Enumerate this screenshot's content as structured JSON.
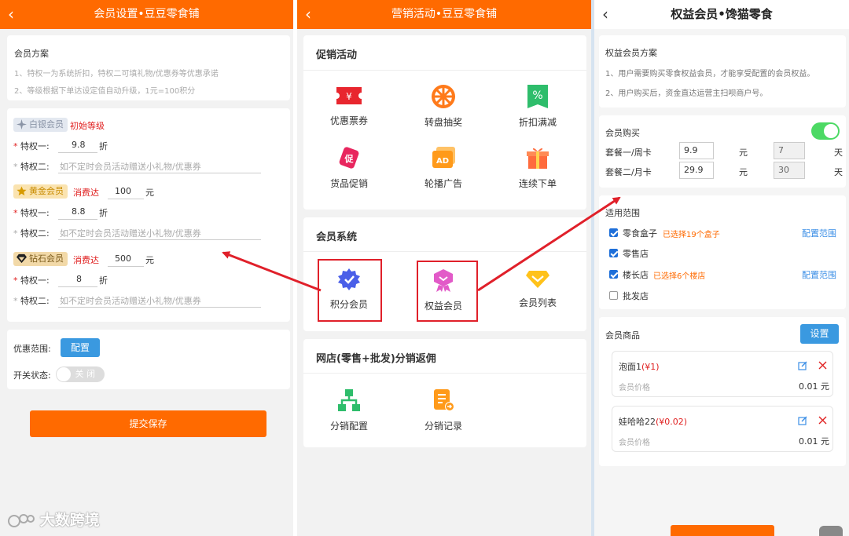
{
  "panel1": {
    "title": "会员设置•豆豆零食铺",
    "plan_title": "会员方案",
    "plan_notes": [
      "1、特权一为系统折扣，特权二可填礼物/优惠券等优惠承诺",
      "2、等级根据下单达设定值自动升级，1元=100积分"
    ],
    "levels": [
      {
        "badge": "白银会员",
        "tag": "初始等级",
        "priv1_label": "特权一:",
        "priv1_value": "9.8",
        "unit": "折",
        "priv2_label": "特权二:",
        "priv2_placeholder": "如不定时会员活动赠送小礼物/优惠券"
      },
      {
        "badge": "黄金会员",
        "tag": "消费达",
        "amount": "100",
        "amount_unit": "元",
        "priv1_label": "特权一:",
        "priv1_value": "8.8",
        "unit": "折",
        "priv2_label": "特权二:",
        "priv2_placeholder": "如不定时会员活动赠送小礼物/优惠券"
      },
      {
        "badge": "钻石会员",
        "tag": "消费达",
        "amount": "500",
        "amount_unit": "元",
        "priv1_label": "特权一:",
        "priv1_value": "8",
        "unit": "折",
        "priv2_label": "特权二:",
        "priv2_placeholder": "如不定时会员活动赠送小礼物/优惠券"
      }
    ],
    "scope_label": "优惠范围:",
    "scope_button": "配置",
    "switch_label": "开关状态:",
    "switch_state": "关 闭",
    "submit": "提交保存",
    "watermark": "大数跨境"
  },
  "panel2": {
    "title": "营销活动•豆豆零食铺",
    "sections": [
      {
        "title": "促销活动",
        "items": [
          "优惠票券",
          "转盘抽奖",
          "折扣满减",
          "货品促销",
          "轮播广告",
          "连续下单"
        ]
      },
      {
        "title": "会员系统",
        "items": [
          "积分会员",
          "权益会员",
          "会员列表"
        ]
      },
      {
        "title": "网店(零售+批发)分销返佣",
        "items": [
          "分销配置",
          "分销记录"
        ]
      }
    ]
  },
  "panel3": {
    "title": "权益会员•馋猫零食",
    "plan_title": "权益会员方案",
    "plan_notes": [
      "1、用户需要购买零食权益会员，才能享受配置的会员权益。",
      "2、用户购买后，资金直达运营主扫呗商户号。"
    ],
    "purchase_label": "会员购买",
    "packages": [
      {
        "name": "套餐一/周卡",
        "price": "9.9",
        "price_unit": "元",
        "days": "7",
        "days_unit": "天"
      },
      {
        "name": "套餐二/月卡",
        "price": "29.9",
        "price_unit": "元",
        "days": "30",
        "days_unit": "天"
      }
    ],
    "scope_title": "适用范围",
    "scopes": [
      {
        "label": "零食盒子",
        "note": "已选择19个盒子",
        "link": "配置范围",
        "checked": true
      },
      {
        "label": "零售店",
        "note": "",
        "link": "",
        "checked": true
      },
      {
        "label": "楼长店",
        "note": "已选择6个楼店",
        "link": "配置范围",
        "checked": true
      },
      {
        "label": "批发店",
        "note": "",
        "link": "",
        "checked": false
      }
    ],
    "goods_title": "会员商品",
    "goods_button": "设置",
    "goods": [
      {
        "name": "泡面1",
        "price_tag": "(¥1)",
        "member_price_label": "会员价格",
        "member_price": "0.01 元"
      },
      {
        "name": "娃哈哈22",
        "price_tag": "(¥0.02)",
        "member_price_label": "会员价格",
        "member_price": "0.01 元"
      }
    ]
  },
  "colors": {
    "brand_orange": "#ff6a00",
    "highlight_red": "#e0202a",
    "toggle_green": "#4cd964",
    "link_blue": "#3a8ee6"
  }
}
